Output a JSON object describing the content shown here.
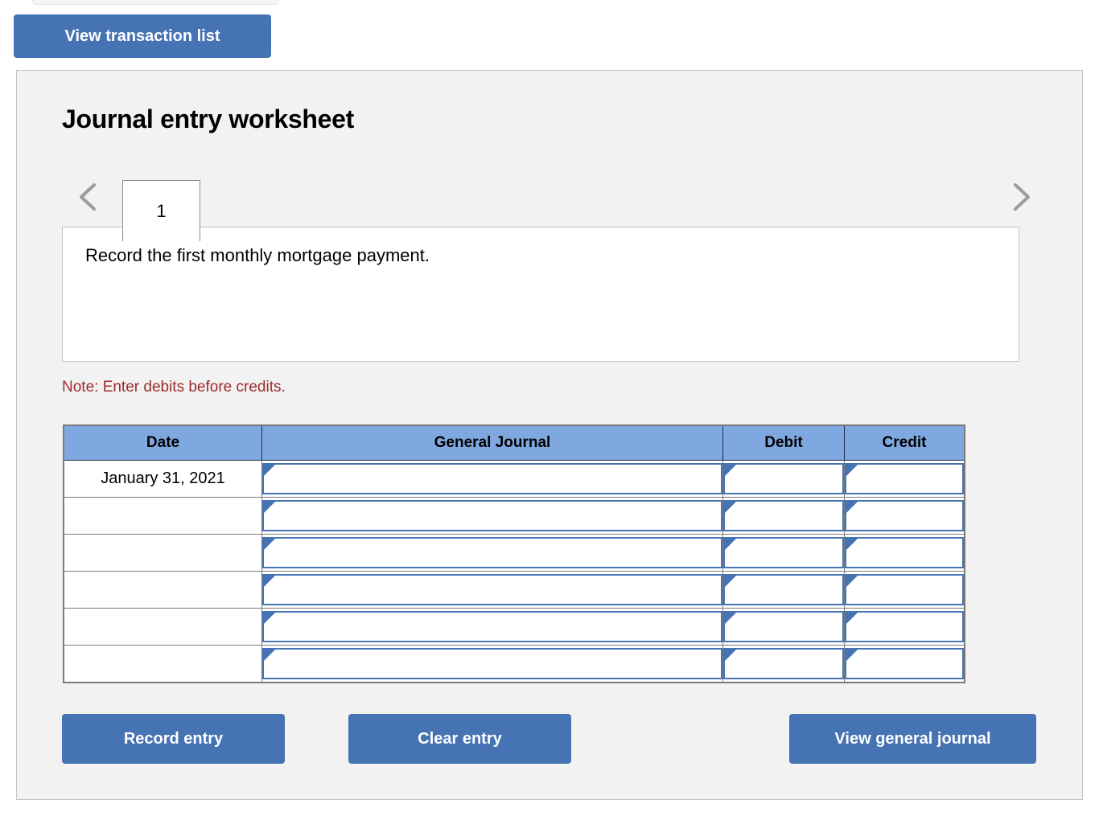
{
  "top": {
    "view_transaction_list_label": "View transaction list"
  },
  "panel": {
    "title": "Journal entry worksheet",
    "tabs": [
      {
        "label": "1",
        "active": true
      }
    ],
    "nav": {
      "prev_icon": "chevron-left-icon",
      "next_icon": "chevron-right-icon"
    },
    "description": "Record the first monthly mortgage payment.",
    "note": "Note: Enter debits before credits."
  },
  "table": {
    "columns": [
      "Date",
      "General Journal",
      "Debit",
      "Credit"
    ],
    "rows": [
      {
        "date": "January 31, 2021",
        "general_journal": "",
        "debit": "",
        "credit": ""
      },
      {
        "date": "",
        "general_journal": "",
        "debit": "",
        "credit": ""
      },
      {
        "date": "",
        "general_journal": "",
        "debit": "",
        "credit": ""
      },
      {
        "date": "",
        "general_journal": "",
        "debit": "",
        "credit": ""
      },
      {
        "date": "",
        "general_journal": "",
        "debit": "",
        "credit": ""
      },
      {
        "date": "",
        "general_journal": "",
        "debit": "",
        "credit": ""
      }
    ]
  },
  "actions": {
    "record_entry_label": "Record entry",
    "clear_entry_label": "Clear entry",
    "view_general_journal_label": "View general journal"
  },
  "colors": {
    "button_blue": "#4573b3",
    "header_blue": "#7fa8e0",
    "note_red": "#9e2a2b",
    "panel_bg": "#f2f2f2",
    "panel_border": "#c4c4c4"
  }
}
